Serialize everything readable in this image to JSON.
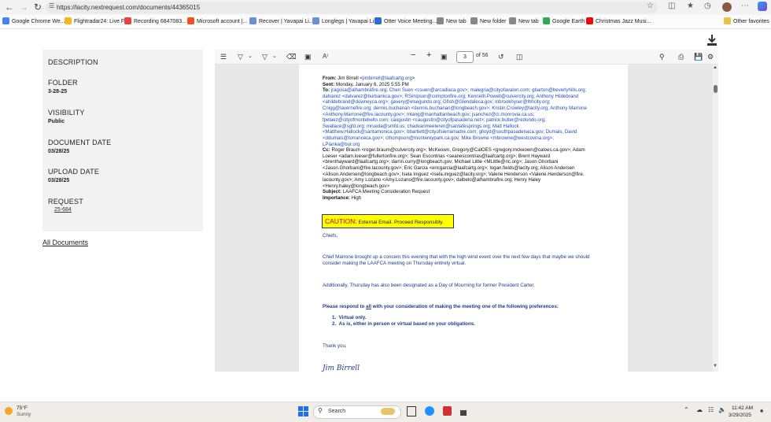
{
  "browser": {
    "url": "https://lacity.nextrequest.com/documents/44365015",
    "bookmarks": [
      {
        "label": "Google Chrome We...",
        "color": "#4285f4"
      },
      {
        "label": "Flightradar24: Live F...",
        "color": "#f3b61f"
      },
      {
        "label": "Recording 6847083...",
        "color": "#e8453c"
      },
      {
        "label": "Microsoft account |...",
        "color": "#f25022"
      },
      {
        "label": "Recover | Yavapai Li...",
        "color": "#6a8fd3"
      },
      {
        "label": "Longlegs | Yavapai Li...",
        "color": "#6a8fd3"
      },
      {
        "label": "Otter Voice Meeting...",
        "color": "#2b6cd6"
      },
      {
        "label": "New tab",
        "color": "#888888"
      },
      {
        "label": "New folder",
        "color": "#888888"
      },
      {
        "label": "New tab",
        "color": "#888888"
      },
      {
        "label": "Google Earth",
        "color": "#34a853"
      },
      {
        "label": "Christmas Jazz Musi...",
        "color": "#ff0000"
      }
    ],
    "other_favorites": "Other favorites"
  },
  "document_meta": {
    "description_label": "DESCRIPTION",
    "folder_label": "FOLDER",
    "folder_value": "3-28-25",
    "visibility_label": "VISIBILITY",
    "visibility_value": "Public",
    "document_date_label": "DOCUMENT DATE",
    "document_date_value": "03/28/25",
    "upload_date_label": "UPLOAD DATE",
    "upload_date_value": "03/28/25",
    "request_label": "REQUEST",
    "request_value": "25-684",
    "all_documents": "All Documents"
  },
  "pdf_toolbar": {
    "current_page": "3",
    "of_pages": "of 56"
  },
  "email": {
    "from_label": "From:",
    "from_name": "Jim Birrell <",
    "from_email": "jimbirrell@laafcartg.org",
    "sent_label": "Sent:",
    "sent_value": "Monday, January 6, 2025 5:55 PM",
    "to_label": "To:",
    "to_line_1": "jragusa@alhambrafire.org; Chen Suen <csuen@arcadiaca.gov>; malegria@cityofavalon.com; gbarton@beverlyhills.org;",
    "to_line_2": "dalvarez <dalvarez@burbankca.gov>; RSimpson@comptonfire.org; Kenneth.Powell@culvercity.org; Anthony Hildebrand",
    "to_line_3": "<ahildebrand@downeyca.org>; gavery@elsegundo.org; Gfish@Glendaleca.gov; mbrookhyser@lhhcity.org;",
    "to_line_4": "Cnigg@lavernefire.org; dennis.buchanan <dennis.buchanan@longbeach.gov>; Kristin.Crowley@lacity.org; Anthony Marrone",
    "to_line_5": "<Anthony.Marrone@fire.lacounty.gov>; mlang@manhattanbeach.gov; jsanchez@ci.monrovia.ca.us;",
    "to_line_6": "fpelaez@cityofmontebello.com; caugustin <caugustin@cityofpasadena.net>; patrick.butler@redondo.org;",
    "to_line_7": "Swallace@sgfd.org; mrueda@smfd.us; chadvanmeeteren@santafesprings.org; Matt Hallock",
    "to_line_8": "<Matthew.Hallock@santamonica.gov>; bbartlett@cityofsierramadre.com; glloyd@southpasadenaca.gov; Dumais, David",
    "to_line_9": "<ddumais@torranceca.gov>; cthompson@montereypark.ca.gov; Mike Browne <mbrowne@westcovina.org>;",
    "to_line_10": "LPianka@bur.org",
    "cc_label": "Cc:",
    "cc_line_1": "Roger Braum <roger.braum@culvercity.org>; McKeown, Gregory@CalOES <gregory.mckeown@caloes.ca.gov>; Adam",
    "cc_line_2": "Loeser <adam.loeser@fullertonfire.org>; Sean Escontrias <seanescontrias@laafcartg.org>; Brent Hayward",
    "cc_line_3": "<brenthayward@laafcartg.org>; darrin.curry@longbeach.gov; Michael Little <MLittle@ric.org>; Jason Ghorbani",
    "cc_line_4": "<Jason.Ghorbani@fire.lacounty.gov>; Eric Garcia <ericgarcia@laafcartg.org>; logan.fields@lacity.org; Alison Andersen",
    "cc_line_5": "<Alison.Andersen@longbeach.gov>; Isela Iniguez <isela.iniguez@lacity.org>; Valerie Henderson <Valerie.Henderson@fire.",
    "cc_line_6": "lacounty.gov>; Amy Lozano <Amy.Lozano@fire.lacounty.gov>; dalbelo@alhambrafire.org; Henry Haley",
    "cc_line_7": "<Henry.haley@longbeach.gov>",
    "subject_label": "Subject:",
    "subject_value": "LAAFCA Meeting Consideration Request",
    "importance_label": "Importance:",
    "importance_value": "High",
    "caution_word": "CAUTION:",
    "caution_text": "External Email. Proceed Responsibly.",
    "greeting": "Chiefs,",
    "para_1": "Chief Marrone brought up a concern this evening that with the high wind event over the next few days that maybe we should consider making the LAAFCA meeting on Thursday entirely virtual.",
    "para_2": "Additionally, Thursday has also been designated as a Day of Mourning for former President Carter.",
    "request_pre": "Please respond to ",
    "request_all": "all",
    "request_post": " with your consideration of making the meeting one of the following preferences:",
    "option_1": "Virtual only.",
    "option_2": "As is, either in person or virtual based on your obligations.",
    "closing": "Thank you,",
    "signature": "Jim Birrell"
  },
  "taskbar": {
    "temperature": "75°F",
    "condition": "Sunny",
    "search_placeholder": "Search",
    "time": "11:42 AM",
    "date": "3/29/2025"
  }
}
